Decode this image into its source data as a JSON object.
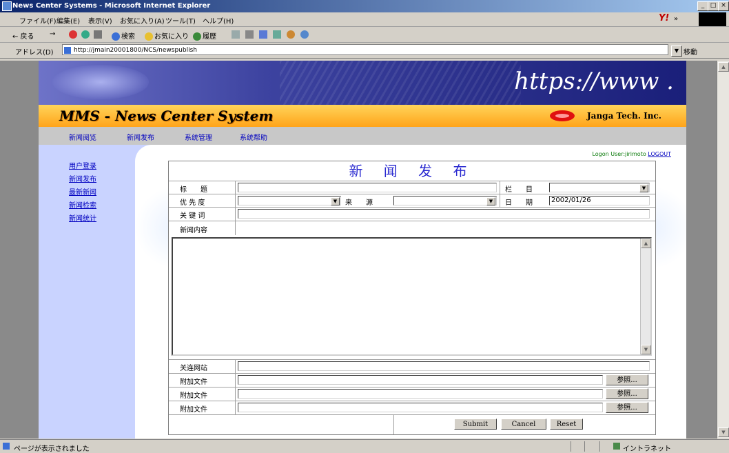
{
  "window": {
    "title": "News Center Systems - Microsoft Internet Explorer",
    "min": "_",
    "max": "□",
    "close": "×"
  },
  "menubar": {
    "items": [
      "ファイル(F)",
      "編集(E)",
      "表示(V)",
      "お気に入り(A)",
      "ツール(T)",
      "ヘルプ(H)"
    ],
    "brand": "Y!",
    "chevron": "»"
  },
  "toolbar": {
    "back": "← 戻る",
    "forward": "→",
    "search": "検索",
    "favorites": "お気に入り",
    "history": "履歴"
  },
  "address": {
    "label": "アドレス(D)",
    "url": "http://jmain20001800/NCS/newspublish",
    "go": "移動"
  },
  "site": {
    "banner_text": "https://www .",
    "system_title": "MMS - News Center System",
    "company": "Janga Tech. Inc.",
    "nav": [
      "新闻阅览",
      "新闻发布",
      "系统管理",
      "系统帮助"
    ],
    "side_links": [
      "用户登录",
      "新闻发布",
      "最新新闻",
      "新闻检索",
      "新闻统计"
    ],
    "logon_text": "Logon User:jirimoto",
    "logout": "LOGOUT"
  },
  "form": {
    "title": "新 闻 发 布",
    "labels": {
      "title": "标　　题",
      "column": "栏　　目",
      "priority": "优 先 度",
      "source": "来　　源",
      "date": "日　　期",
      "keywords": "关 键 词",
      "content": "新闻内容",
      "related": "关连网站",
      "attach1": "附加文件",
      "attach2": "附加文件",
      "attach3": "附加文件"
    },
    "values": {
      "date": "2002/01/26"
    },
    "browse": [
      "参照...",
      "参照...",
      "参照..."
    ],
    "buttons": {
      "submit": "Submit",
      "cancel": "Cancel",
      "reset": "Reset"
    }
  },
  "status": {
    "message": "ページが表示されました",
    "zone": "イントラネット"
  }
}
